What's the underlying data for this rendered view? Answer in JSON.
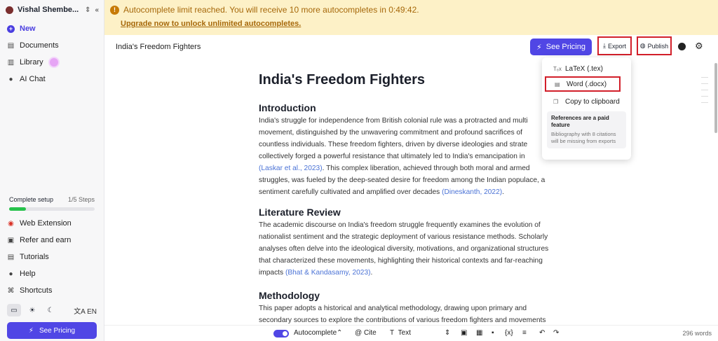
{
  "sidebar": {
    "workspace_name": "Vishal Shembe...",
    "nav": {
      "new": "New",
      "documents": "Documents",
      "library": "Library",
      "ai_chat": "AI Chat"
    },
    "setup": {
      "label": "Complete setup",
      "steps": "1/5 Steps",
      "progress": 0.2
    },
    "links": {
      "web_extension": "Web Extension",
      "refer": "Refer and earn",
      "tutorials": "Tutorials",
      "help": "Help",
      "shortcuts": "Shortcuts"
    },
    "language": "EN",
    "pricing_button": "See Pricing"
  },
  "banner": {
    "message": "Autocomplete limit reached. You will receive 10 more autocompletes in 0:49:42.",
    "upgrade": "Upgrade now to unlock unlimited autocompletes."
  },
  "topbar": {
    "doc_name": "India's Freedom Fighters",
    "pricing": "See Pricing",
    "export": "Export",
    "publish": "Publish"
  },
  "export_menu": {
    "latex": "LaTeX (.tex)",
    "word": "Word (.docx)",
    "clipboard": "Copy to clipboard",
    "note_title": "References are a paid feature",
    "note_desc": "Bibliography with 8 citations will be missing from exports"
  },
  "document": {
    "title": "India's Freedom Fighters",
    "sections": [
      {
        "heading": "Introduction",
        "lines": [
          "India's struggle for independence from British colonial rule was a protracted and multi",
          "movement, distinguished by the unwavering commitment and profound sacrifices of",
          "countless individuals. These freedom fighters, driven by diverse ideologies and strate",
          "collectively forged a powerful resistance that ultimately led to India's emancipation in"
        ],
        "cite1": "(Laskar et al., 2023)",
        "line5_rest": ". This complex liberation, achieved through both moral and armed",
        "line6": "struggles, was fueled by the deep-seated desire for freedom among the Indian populace, a",
        "line7": "sentiment carefully cultivated and amplified over decades",
        "cite2": "(Dineskanth, 2022)",
        "end": "."
      },
      {
        "heading": "Literature Review",
        "lines": [
          "The academic discourse on India's freedom struggle frequently examines the evolution of",
          "nationalist sentiment and the strategic deployment of various resistance methods. Scholarly",
          "analyses often delve into the ideological diversity, motivations, and organizational structures",
          "that characterized these movements, highlighting their historical contexts and far-reaching"
        ],
        "line5": "impacts",
        "cite1": "(Bhat & Kandasamy, 2023)",
        "end": "."
      },
      {
        "heading": "Methodology",
        "lines": [
          "This paper adopts a historical and analytical methodology, drawing upon primary and",
          "secondary sources to explore the contributions of various freedom fighters and movements"
        ]
      }
    ]
  },
  "toolbar": {
    "autocomplete": "Autocomplete",
    "cite": "Cite",
    "text": "Text",
    "word_count": "296 words"
  }
}
